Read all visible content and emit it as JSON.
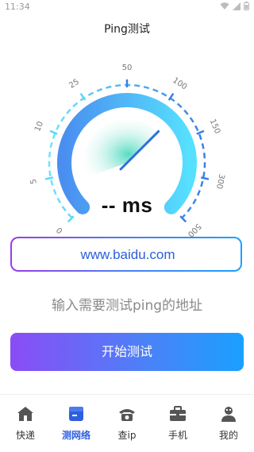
{
  "status_bar": {
    "time": "11:34",
    "extra": "◎"
  },
  "header": {
    "title": "Ping测试"
  },
  "gauge": {
    "ticks": [
      "0",
      "5",
      "10",
      "25",
      "50",
      "100",
      "150",
      "300",
      "500"
    ],
    "value_text": "-- ms",
    "colors": {
      "start": "#4a8ff0",
      "end": "#56e0ff",
      "needle": "#2f6fd8",
      "dash": "#5cc8ff"
    }
  },
  "search": {
    "value": "www.baidu.com",
    "placeholder": ""
  },
  "hint": "输入需要测试ping的地址",
  "start_button": {
    "label": "开始测试"
  },
  "tabs": [
    {
      "label": "快递",
      "icon": "home-icon",
      "active": false
    },
    {
      "label": "测网络",
      "icon": "box-icon",
      "active": true
    },
    {
      "label": "查ip",
      "icon": "phone-icon",
      "active": false
    },
    {
      "label": "手机",
      "icon": "toolbox-icon",
      "active": false
    },
    {
      "label": "我的",
      "icon": "user-icon",
      "active": false
    }
  ]
}
